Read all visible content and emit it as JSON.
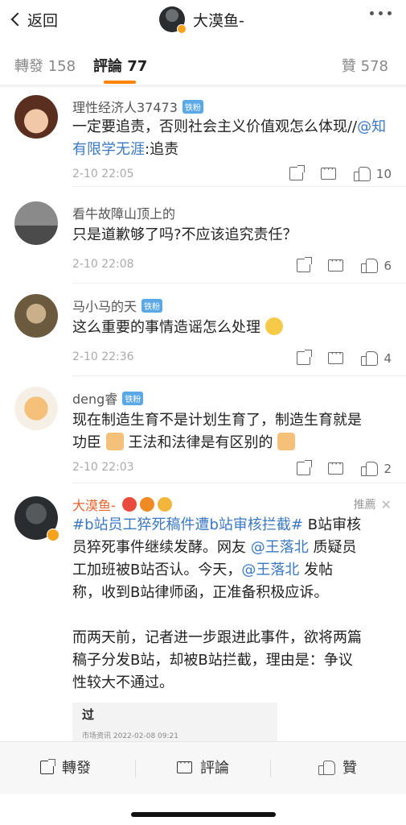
{
  "header": {
    "back_label": "返回",
    "title": "大漠鱼-"
  },
  "tabs": [
    {
      "label": "轉發 158"
    },
    {
      "label": "評論 77"
    },
    {
      "label": "贊 578"
    }
  ],
  "comments": [
    {
      "name": "理性经济人37473",
      "badge": "铁粉",
      "text_main": "一定要追责，否则社会主义价值观怎么体现//",
      "text_link": "@知有限学无涯",
      "text_tail": ":追责",
      "time": "2-10 22:05",
      "likes": "10"
    },
    {
      "name": "看牛故障山顶上的",
      "text_main": "只是道歉够了吗?不应该追究责任？",
      "time": "2-10 22:08",
      "likes": "6"
    },
    {
      "name": "马小马的天",
      "badge": "铁粉",
      "text_main": "这么重要的事情造谣怎么处理",
      "time": "2-10 22:36",
      "likes": "4"
    },
    {
      "name": "deng睿",
      "badge": "铁粉",
      "text_line1": "现在制造生育不是计划生育了，制造生育就是",
      "text_line2a": "功臣",
      "text_line2b": "王法和法律是有区别的",
      "time": "2-10 22:03",
      "likes": "2"
    }
  ],
  "promoted": {
    "name": "大漠鱼-",
    "tag": "推薦",
    "hashtag": "#b站员工猝死稿件遭b站审核拦截#",
    "line1_tail": "B站审核",
    "line2": "员猝死事件继续发酵。网友",
    "mention1": "@王落北",
    "line2_tail": "质疑员",
    "line3a": "工加班被B站否认。今天，",
    "mention2": "@王落北",
    "line3_tail": "发帖",
    "line4": "称，收到B站律师函，正准备积极应诉。",
    "para2_line1": "而两天前，记者进一步跟进此事件，欲将两篇",
    "para2_line2": "稿子分发B站，却被B站拦截，理由是：争议",
    "para2_line3": "性较大不通过。",
    "image_title": "过",
    "image_meta": "市场资讯 2022-02-08 09:21"
  },
  "bottom_bar": {
    "repost": "轉發",
    "comment": "評論",
    "like": "贊"
  }
}
